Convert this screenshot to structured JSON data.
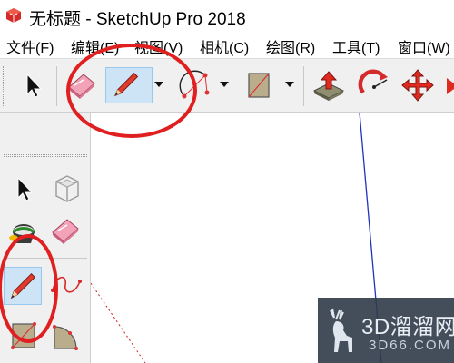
{
  "window": {
    "title": "无标题 - SketchUp Pro 2018"
  },
  "menu": {
    "items": [
      {
        "label": "文件(F)"
      },
      {
        "label": "编辑(E)"
      },
      {
        "label": "视图(V)"
      },
      {
        "label": "相机(C)"
      },
      {
        "label": "绘图(R)"
      },
      {
        "label": "工具(T)"
      },
      {
        "label": "窗口(W)"
      }
    ]
  },
  "toolbar": {
    "tools": [
      "select-tool",
      "eraser-tool",
      "line-tool",
      "arc-tool",
      "rectangle-tool",
      "push-pull-tool",
      "rotate-tool",
      "move-tool"
    ],
    "active_tool": "line-tool"
  },
  "left_panel": {
    "tools": [
      "select-tool",
      "component-tool",
      "paint-bucket-tool",
      "eraser-tool",
      "line-tool",
      "freehand-tool",
      "rectangle-tool",
      "pie-tool"
    ],
    "active_tool": "line-tool"
  },
  "watermark": {
    "title": "3D溜溜网",
    "subtitle": "3D66.COM"
  },
  "colors": {
    "annotation": "#e02020",
    "active_tool_bg": "#cde4f7",
    "axis_blue": "#2233bb",
    "axis_red": "#cc2222",
    "toolbar_bg": "#f0f0f0"
  }
}
